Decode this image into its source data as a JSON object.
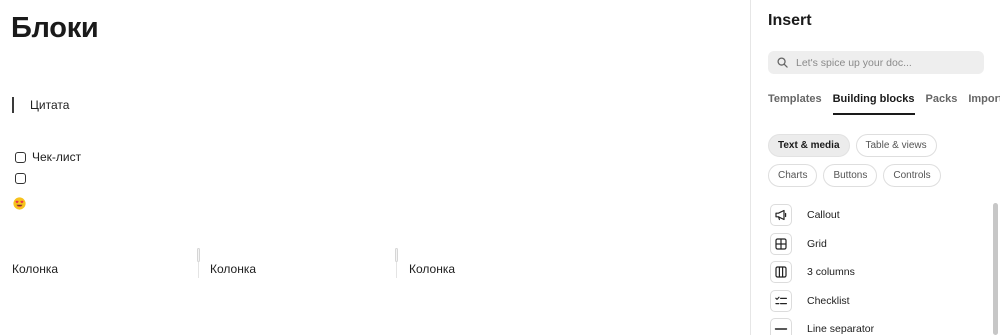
{
  "document": {
    "title": "Блоки",
    "quote": "Цитата",
    "checklist": [
      "Чек-лист",
      ""
    ],
    "emoji_icon": "heart-eyes-emoji-icon",
    "columns": [
      "Колонка",
      "Колонка",
      "Колонка"
    ]
  },
  "panel": {
    "title": "Insert",
    "search_placeholder": "Let's spice up your doc...",
    "tabs": [
      "Templates",
      "Building blocks",
      "Packs",
      "Import"
    ],
    "active_tab": "Building blocks",
    "chips": [
      "Text & media",
      "Table & views",
      "Charts",
      "Buttons",
      "Controls"
    ],
    "active_chip": "Text & media",
    "blocks": [
      {
        "label": "Callout",
        "icon": "megaphone-icon"
      },
      {
        "label": "Grid",
        "icon": "grid-icon"
      },
      {
        "label": "3 columns",
        "icon": "three-columns-icon"
      },
      {
        "label": "Checklist",
        "icon": "checklist-icon"
      },
      {
        "label": "Line separator",
        "icon": "line-separator-icon"
      }
    ]
  },
  "colors": {
    "text": "#1f1f1f",
    "muted": "#666666",
    "chip_active_bg": "#ececec",
    "search_bg": "#eeeeee"
  }
}
